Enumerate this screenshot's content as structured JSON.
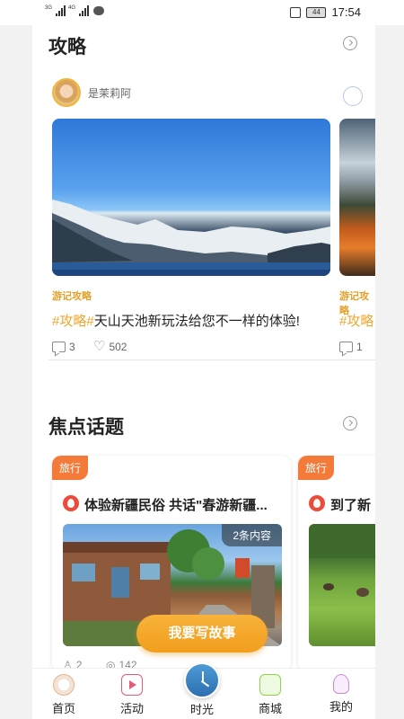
{
  "status_bar": {
    "signal1_tag": "3G",
    "signal2_tag": "4G",
    "battery": "44",
    "time": "17:54"
  },
  "guide_section": {
    "title": "攻略",
    "author": {
      "name": "是茉莉阿"
    },
    "main_post": {
      "category": "游记攻略",
      "hashtag": "#攻略#",
      "title": "天山天池新玩法给您不一样的体验!",
      "comments": "3",
      "likes": "502"
    },
    "side_post": {
      "category": "游记攻略",
      "hashtag": "#攻略",
      "comments": "1"
    }
  },
  "topics_section": {
    "title": "焦点话题",
    "cards": [
      {
        "badge": "旅行",
        "title": "体验新疆民俗 共话\"春游新疆...",
        "content_count": "2条内容",
        "participants": "2",
        "views": "142"
      },
      {
        "badge": "旅行",
        "title": "到了新"
      }
    ],
    "write_button": "我要写故事"
  },
  "tab_bar": {
    "items": [
      {
        "label": "首页",
        "icon": "home-icon"
      },
      {
        "label": "活动",
        "icon": "play-icon"
      },
      {
        "label": "时光",
        "icon": "clock-icon"
      },
      {
        "label": "商城",
        "icon": "shopping-bag-icon"
      },
      {
        "label": "我的",
        "icon": "profile-icon"
      }
    ]
  },
  "colors": {
    "accent_gold": "#e3a12a",
    "badge_orange": "#f47a3a",
    "button_orange": "#f19e1d",
    "time_blue": "#2c6fb0"
  }
}
